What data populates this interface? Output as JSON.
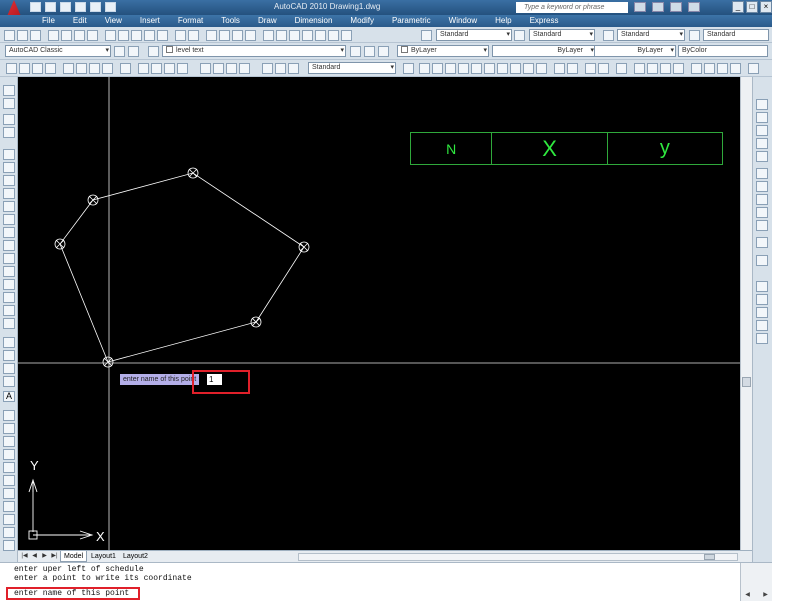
{
  "window": {
    "title": "AutoCAD 2010    Drawing1.dwg",
    "search_placeholder": "Type a keyword or phrase"
  },
  "menu": [
    "File",
    "Edit",
    "View",
    "Insert",
    "Format",
    "Tools",
    "Draw",
    "Dimension",
    "Modify",
    "Parametric",
    "Window",
    "Help",
    "Express"
  ],
  "toolbar_row1": {
    "text_style": "Standard",
    "dim_style": "Standard",
    "table_style": "Standard",
    "multileader_style": "Standard"
  },
  "toolbar_row2": {
    "workspace": "AutoCAD Classic",
    "layer": "level text",
    "color": "ByLayer",
    "linetype": "ByLayer",
    "lineweight": "ByLayer",
    "plot_style": "ByColor"
  },
  "toolbar_row3": {
    "dimension_style": "Standard"
  },
  "drawing": {
    "background": "#000000",
    "line_color": "#ffffff",
    "tooltip": {
      "label": "enter name of this point",
      "input_value": "1"
    },
    "schedule_headers": [
      "N",
      "X",
      "y"
    ],
    "ucs": {
      "x_label": "X",
      "y_label": "Y"
    }
  },
  "layout_tabs": [
    "Model",
    "Layout1",
    "Layout2"
  ],
  "command_history": [
    "enter uper left of schedule",
    "enter a point to write its coordinate"
  ],
  "command_prompt": "enter name of this point",
  "colors": {
    "title_bar": "#2d5e8e",
    "toolbar": "#d7e1ea",
    "schedule_green": "#2fe93f",
    "highlight_red": "#e0202a",
    "tooltip_bg": "#b3aee8"
  }
}
